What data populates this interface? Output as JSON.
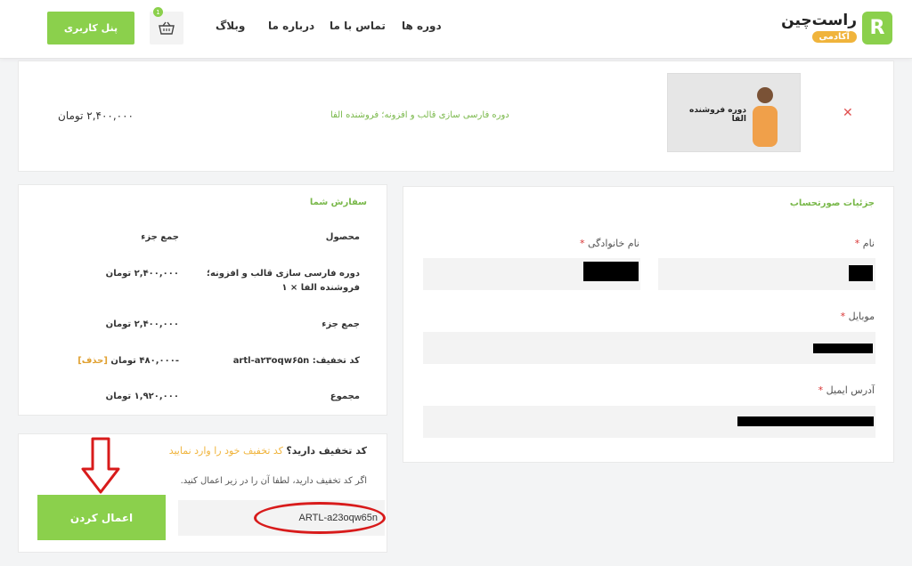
{
  "header": {
    "panel_button": "پنل کاربری",
    "cart_count": "1",
    "nav": [
      "دوره ها",
      "تماس با ما",
      "درباره ما",
      "وبلاگ"
    ],
    "logo_name": "راست‌چین",
    "logo_sub": "آکادمی",
    "logo_mark": "R"
  },
  "cart_item": {
    "product_name": "دوره فارسی سازی قالب و افزونه؛ فروشنده الفا",
    "price": "۲,۴۰۰,۰۰۰ تومان",
    "thumb_title": "دوره فروشنده الفا",
    "remove_icon": "close-icon"
  },
  "order": {
    "title": "سفارش شما",
    "col_product": "محصول",
    "col_subtotal": "جمع جزء",
    "item_line1": "دوره فارسی سازی قالب و افزونه؛",
    "item_line2": "فروشنده الفا × ۱",
    "item_price": "۲,۴۰۰,۰۰۰ تومان",
    "subtotal_label": "جمع جزء",
    "subtotal_value": "۲,۴۰۰,۰۰۰ تومان",
    "discount_label": "کد تخفیف: artl-a۲۳oqw۶۵n",
    "discount_value": "-۴۸۰,۰۰۰ تومان",
    "discount_remove": "[حذف]",
    "total_label": "مجموع",
    "total_value": "۱,۹۲۰,۰۰۰ تومان"
  },
  "coupon": {
    "question": "کد تخفیف دارید؟",
    "hint": "کد تخفیف خود را وارد نمایید",
    "description": "اگر کد تخفیف دارید، لطفا آن را در زیر اعمال کنید.",
    "input_value": "ARTL-a23oqw65n",
    "apply_button": "اعمال کردن"
  },
  "billing": {
    "title": "جزئیات صورتحساب",
    "first_name_label": "نام",
    "last_name_label": "نام خانوادگی",
    "mobile_label": "موبایل",
    "email_label": "آدرس ایمیل",
    "required_mark": "*"
  },
  "colors": {
    "accent": "#8bd04c",
    "accent_text": "#79b84a",
    "warning": "#f0b43c",
    "annotation_red": "#d81b1b"
  }
}
